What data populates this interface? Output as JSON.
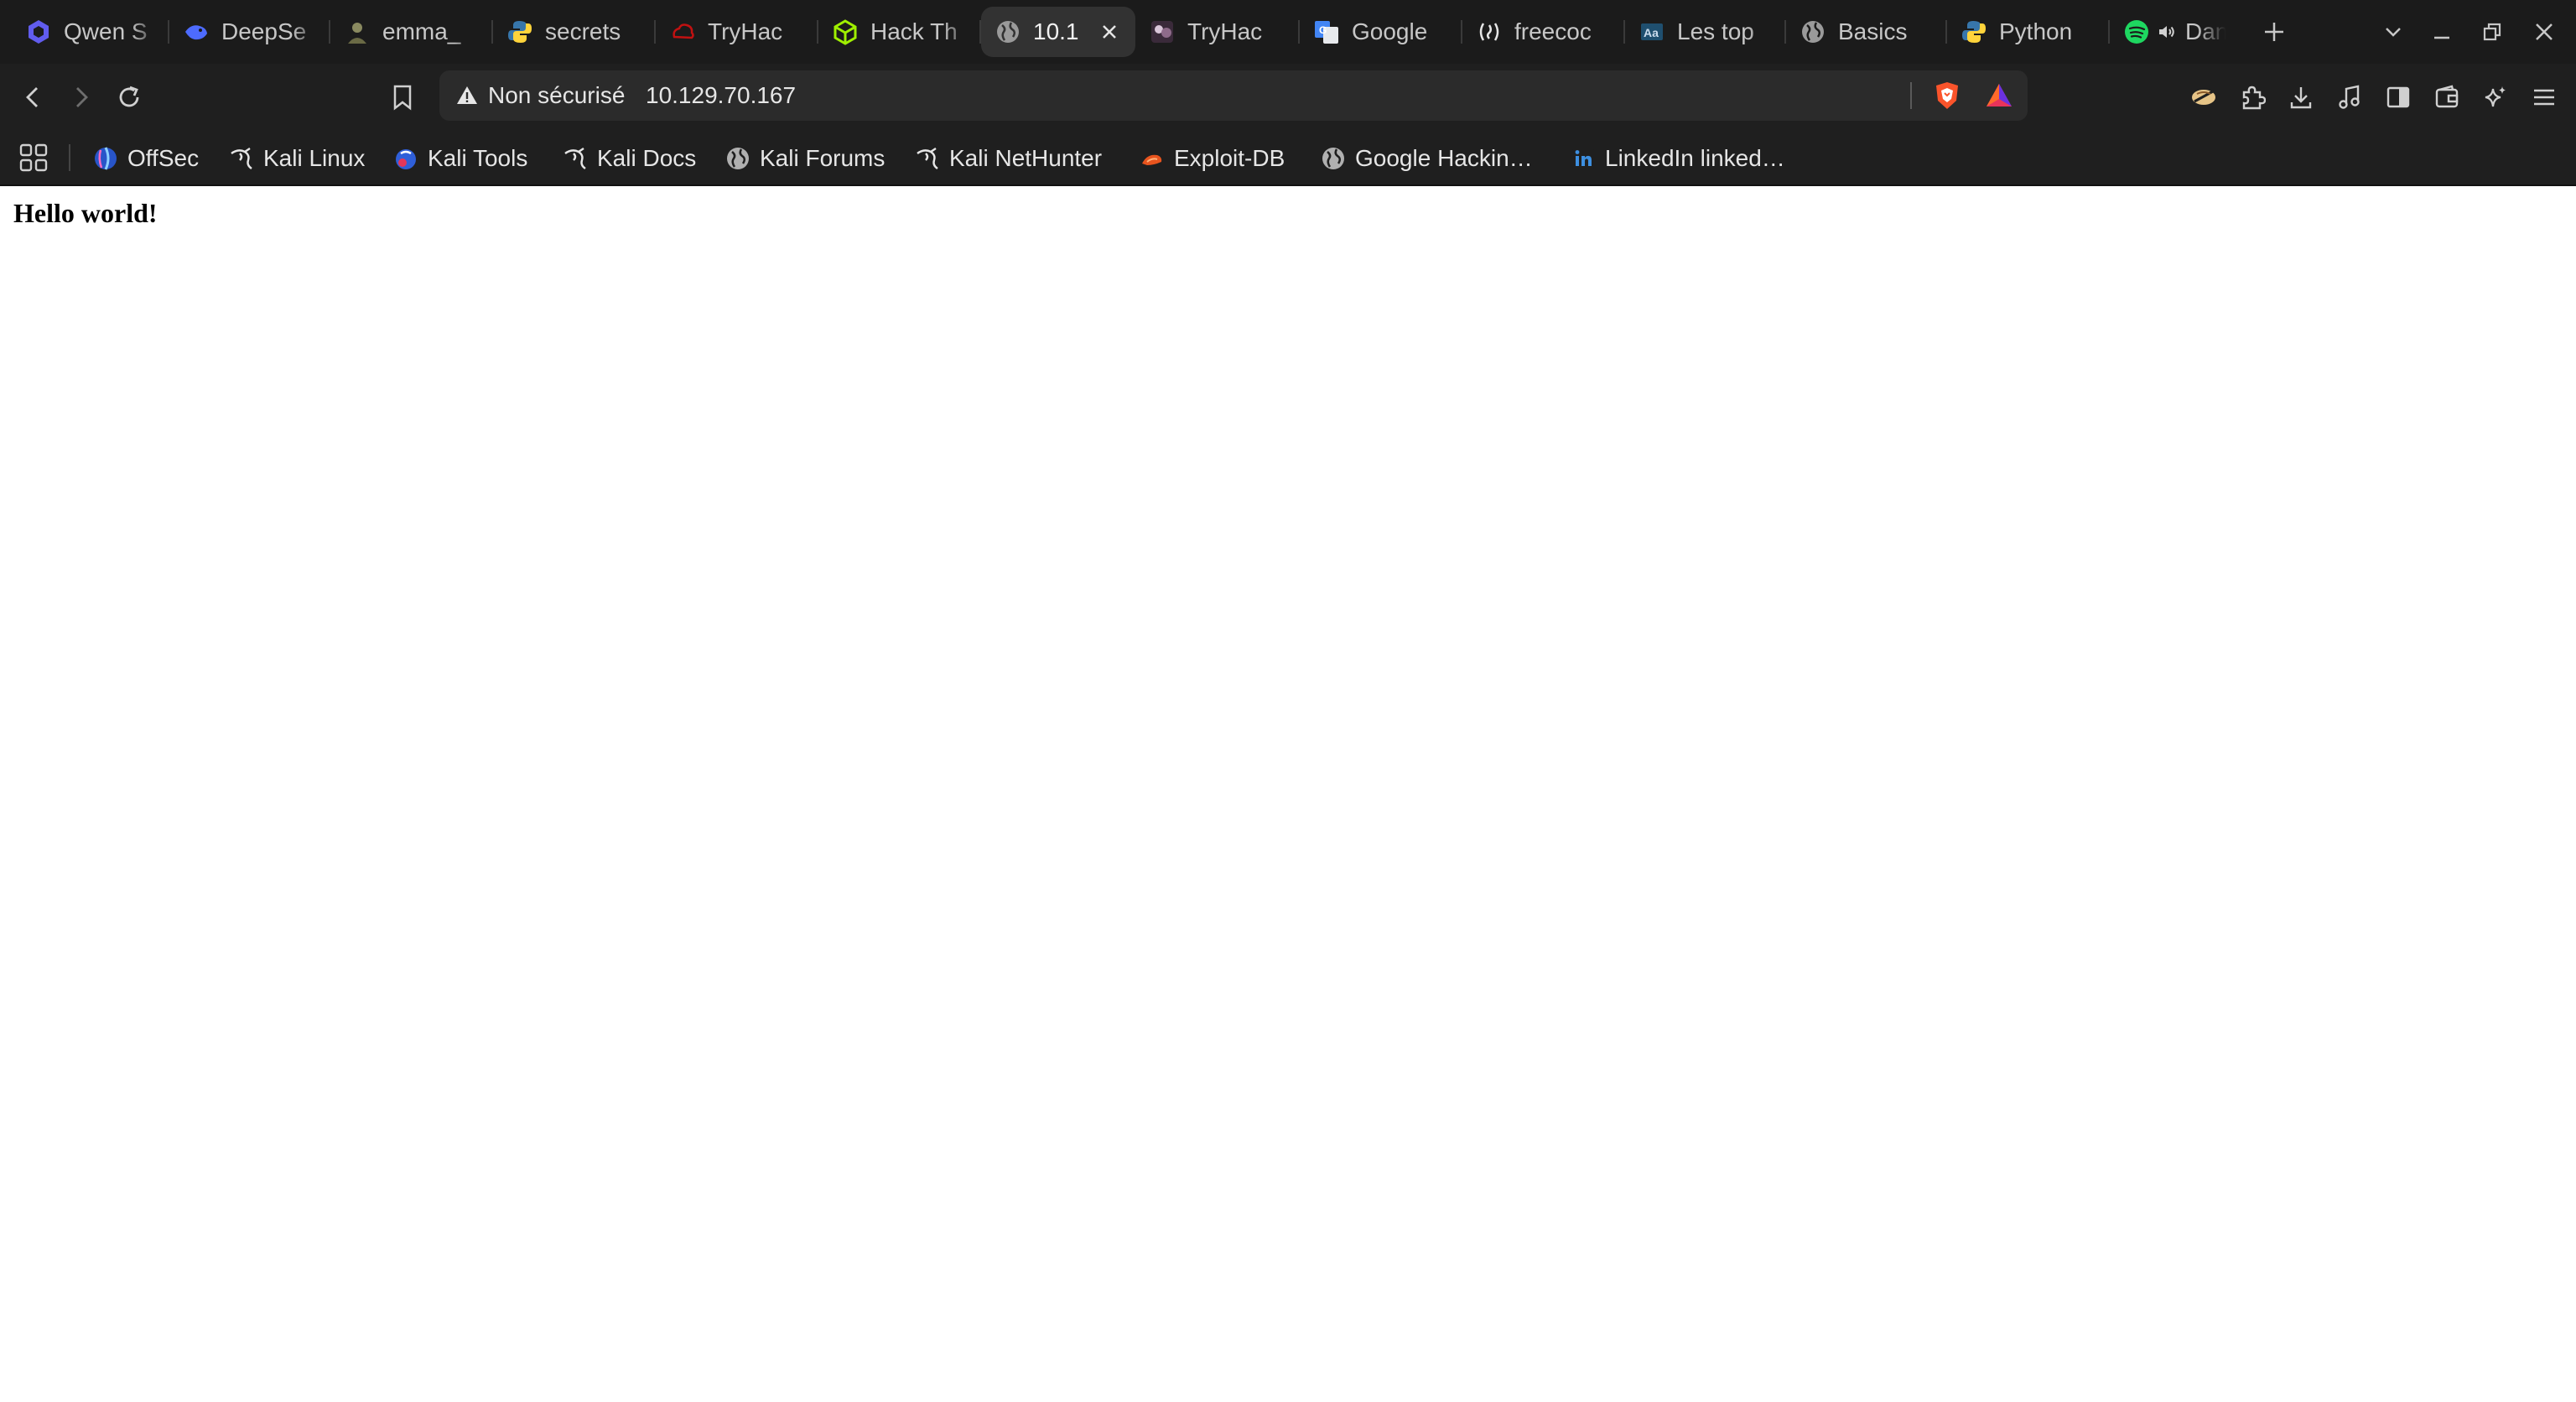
{
  "tabs": [
    {
      "title": "Qwen S",
      "icon": "qwen-icon",
      "color": "#615ced"
    },
    {
      "title": "DeepSe",
      "icon": "deepseek-icon",
      "color": "#4d6bfe"
    },
    {
      "title": "emma_",
      "icon": "emma-avatar-icon",
      "color": "#7a7a55"
    },
    {
      "title": "secrets",
      "icon": "python-icon",
      "color": "#3776ab"
    },
    {
      "title": "TryHac",
      "icon": "tryhackme-icon",
      "color": "#c11111"
    },
    {
      "title": "Hack Th",
      "icon": "hackthebox-icon",
      "color": "#9fef00"
    },
    {
      "title": "10.1",
      "icon": "globe-icon",
      "color": "#9a9a9a",
      "active": true
    },
    {
      "title": "TryHac",
      "icon": "tryhackme-avatar-icon",
      "color": "#8e6b8a"
    },
    {
      "title": "Google",
      "icon": "google-translate-icon",
      "color": "#4285f4"
    },
    {
      "title": "freecoc",
      "icon": "freecodecamp-icon",
      "color": "#2a2a40"
    },
    {
      "title": "Les top",
      "icon": "article-icon",
      "color": "#4a6a8a"
    },
    {
      "title": "Basics",
      "icon": "globe-icon",
      "color": "#9a9a9a"
    },
    {
      "title": "Python",
      "icon": "python-icon",
      "color": "#3776ab"
    },
    {
      "title": "Dan",
      "icon": "spotify-icon",
      "color": "#1ed760",
      "audio": true
    }
  ],
  "omnibox": {
    "security_label": "Non sécurisé",
    "url": "10.129.70.167"
  },
  "bookmarks": [
    {
      "label": "OffSec",
      "icon": "offsec-icon"
    },
    {
      "label": "Kali Linux",
      "icon": "kali-dragon-icon"
    },
    {
      "label": "Kali Tools",
      "icon": "kali-tools-icon"
    },
    {
      "label": "Kali Docs",
      "icon": "kali-dragon-icon"
    },
    {
      "label": "Kali Forums",
      "icon": "globe-icon"
    },
    {
      "label": "Kali NetHunter",
      "icon": "kali-dragon-icon"
    },
    {
      "label": "Exploit-DB",
      "icon": "exploit-db-icon"
    },
    {
      "label": "Google Hackin…",
      "icon": "globe-icon"
    },
    {
      "label": "LinkedIn linked…",
      "icon": "linkedin-icon"
    }
  ],
  "page": {
    "heading": "Hello world!"
  },
  "colors": {
    "tabstrip": "#1b1b1b",
    "toolbar": "#1f1f1f",
    "active_tab": "#323232",
    "omnibox": "#2b2b2b",
    "brave_shield": "#fb542b"
  }
}
